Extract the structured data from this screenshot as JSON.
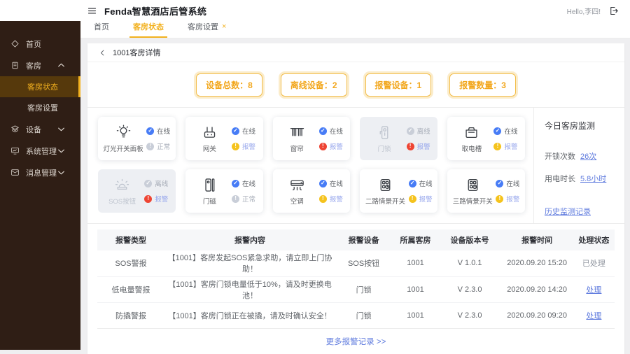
{
  "colors": {
    "gold": "#F2B11F",
    "blue": "#477CF6",
    "yellow": "#F5C31D",
    "red": "#EE4433",
    "gray_dot": "#C9CED8",
    "link": "#5F7BDE",
    "alarm_text": "#95A5EC",
    "sidebar_bg": "#2F1E15",
    "sidebar_active_bg": "#56390C"
  },
  "header": {
    "title": "Fenda智慧酒店后管系统",
    "greeting": "Hello,李四!",
    "menu_icon": "hamburger-icon",
    "logout_icon": "logout-icon"
  },
  "sidebar": {
    "items": [
      {
        "label": "首页",
        "icon": "home-icon"
      },
      {
        "label": "客房",
        "icon": "room-icon",
        "expanded": true,
        "children": [
          {
            "label": "客房状态",
            "active": true
          },
          {
            "label": "客房设置",
            "active": false
          }
        ]
      },
      {
        "label": "设备",
        "icon": "device-icon",
        "expanded": false
      },
      {
        "label": "系统管理",
        "icon": "system-icon",
        "expanded": false
      },
      {
        "label": "消息管理",
        "icon": "message-icon",
        "expanded": false
      }
    ]
  },
  "tabs": {
    "items": [
      {
        "label": "首页",
        "active": false,
        "closable": false
      },
      {
        "label": "客房状态",
        "active": true,
        "closable": false
      },
      {
        "label": "客房设置",
        "active": false,
        "closable": true
      }
    ]
  },
  "breadcrumb": {
    "title": "1001客房详情"
  },
  "stats": {
    "items": [
      {
        "label": "设备总数：",
        "value": "8"
      },
      {
        "label": "离线设备：",
        "value": "2"
      },
      {
        "label": "报警设备：",
        "value": "1"
      },
      {
        "label": "报警数量：",
        "value": "3"
      }
    ]
  },
  "devices": {
    "items": [
      {
        "name": "灯光开关面板",
        "icon": "light-switch-icon",
        "offline": false,
        "connectivity": {
          "label": "在线",
          "type": "online"
        },
        "condition": {
          "label": "正常",
          "type": "normal"
        }
      },
      {
        "name": "网关",
        "icon": "gateway-icon",
        "offline": false,
        "connectivity": {
          "label": "在线",
          "type": "online"
        },
        "condition": {
          "label": "报警",
          "type": "warning"
        }
      },
      {
        "name": "窗帘",
        "icon": "curtain-icon",
        "offline": false,
        "connectivity": {
          "label": "在线",
          "type": "online"
        },
        "condition": {
          "label": "报警",
          "type": "danger"
        }
      },
      {
        "name": "门锁",
        "icon": "door-lock-icon",
        "offline": true,
        "connectivity": {
          "label": "离线",
          "type": "offline"
        },
        "condition": {
          "label": "报警",
          "type": "danger"
        }
      },
      {
        "name": "取电槽",
        "icon": "power-slot-icon",
        "offline": false,
        "connectivity": {
          "label": "在线",
          "type": "online"
        },
        "condition": {
          "label": "报警",
          "type": "warning"
        }
      },
      {
        "name": "SOS按钮",
        "icon": "sos-icon",
        "offline": true,
        "connectivity": {
          "label": "离线",
          "type": "offline"
        },
        "condition": {
          "label": "报警",
          "type": "danger"
        }
      },
      {
        "name": "门磁",
        "icon": "door-sensor-icon",
        "offline": false,
        "connectivity": {
          "label": "在线",
          "type": "online"
        },
        "condition": {
          "label": "正常",
          "type": "normal"
        }
      },
      {
        "name": "空调",
        "icon": "ac-icon",
        "offline": false,
        "connectivity": {
          "label": "在线",
          "type": "online"
        },
        "condition": {
          "label": "报警",
          "type": "warning"
        }
      },
      {
        "name": "二路情景开关",
        "icon": "scene-switch-icon",
        "offline": false,
        "connectivity": {
          "label": "在线",
          "type": "online"
        },
        "condition": {
          "label": "报警",
          "type": "warning"
        }
      },
      {
        "name": "三路情景开关",
        "icon": "scene-switch-icon",
        "offline": false,
        "connectivity": {
          "label": "在线",
          "type": "online"
        },
        "condition": {
          "label": "报警",
          "type": "warning"
        }
      }
    ]
  },
  "monitor": {
    "title": "今日客房监测",
    "metrics": [
      {
        "label": "开锁次数",
        "value": "26次"
      },
      {
        "label": "用电时长",
        "value": "5.8小时"
      }
    ],
    "history_link": "历史监测记录"
  },
  "alarm_table": {
    "columns": [
      "报警类型",
      "报警内容",
      "报警设备",
      "所属客房",
      "设备版本号",
      "报警时间",
      "处理状态"
    ],
    "rows": [
      {
        "cells": [
          "SOS警报",
          "【1001】客房发起SOS紧急求助，请立即上门协助！",
          "SOS按钮",
          "1001",
          "V 1.0.1",
          "2020.09.20 15:20",
          "已处理"
        ],
        "status_style": "muted"
      },
      {
        "cells": [
          "低电量警报",
          "【1001】客房门锁电量低于10%，请及时更换电池！",
          "门锁",
          "1001",
          "V 2.3.0",
          "2020.09.20 14:20",
          "处理"
        ],
        "status_style": "link"
      },
      {
        "cells": [
          "防撬警报",
          "【1001】客房门锁正在被撬，请及时确认安全！",
          "门锁",
          "1001",
          "V 2.3.0",
          "2020.09.20 09:20",
          "处理"
        ],
        "status_style": "link"
      }
    ],
    "more_link": "更多报警记录 >>"
  }
}
